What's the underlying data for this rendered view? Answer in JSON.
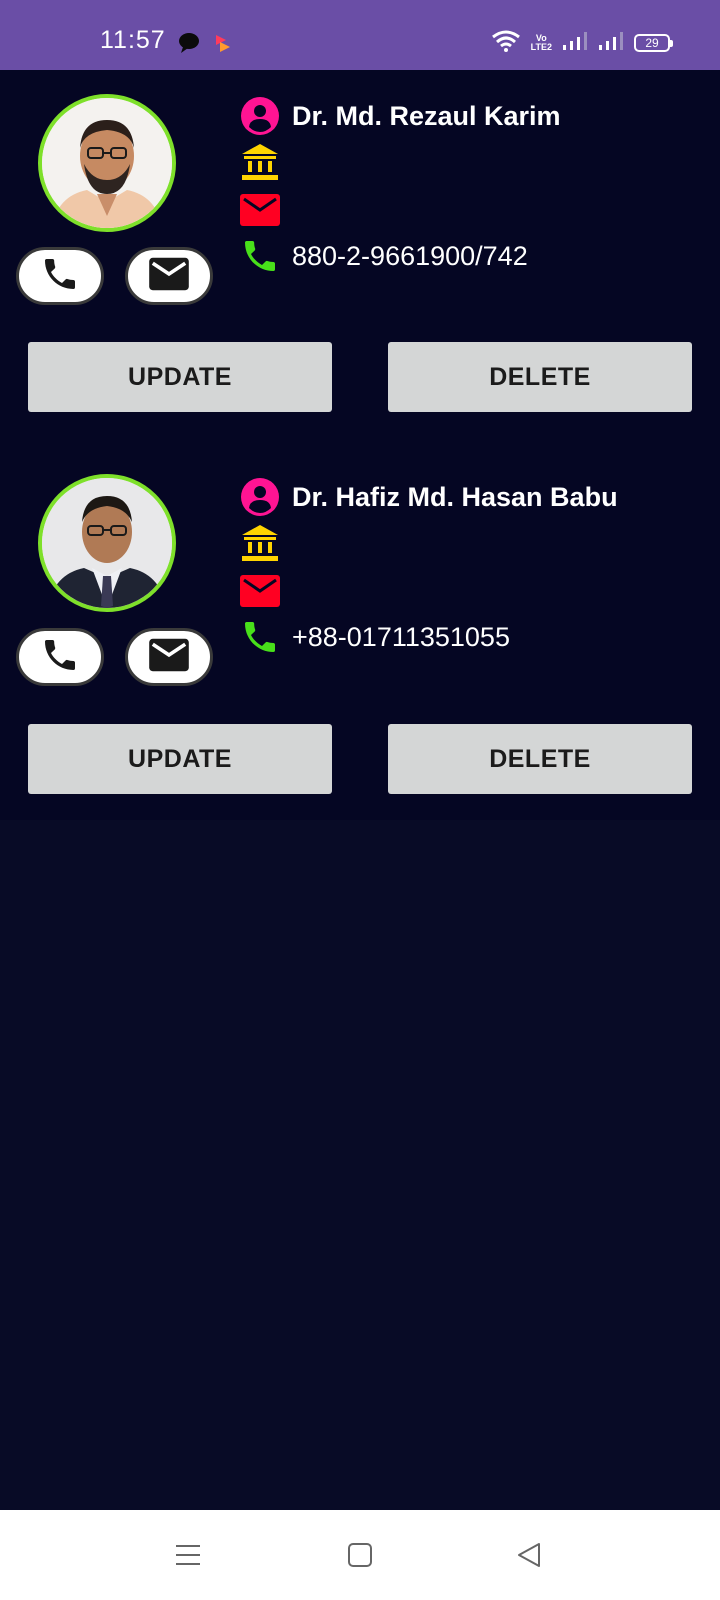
{
  "status_bar": {
    "time": "11:57",
    "network_label_top": "Vo",
    "network_label_bottom": "LTE2",
    "battery": "29"
  },
  "contacts": [
    {
      "name": "Dr. Md. Rezaul Karim",
      "institution": "",
      "email": "",
      "phone": "880-2-9661900/742",
      "update_label": "UPDATE",
      "delete_label": "DELETE"
    },
    {
      "name": "Dr. Hafiz Md. Hasan Babu",
      "institution": "",
      "email": "",
      "phone": "+88-01711351055",
      "update_label": "UPDATE",
      "delete_label": "DELETE"
    }
  ],
  "colors": {
    "status_bar": "#6a4ea6",
    "background": "#080b26",
    "card": "#050623",
    "avatar_border": "#7ee02a",
    "person_icon": "#ff1493",
    "institution_icon": "#ffd400",
    "email_icon": "#ff0022",
    "phone_icon": "#48e01a",
    "button_bg": "#d4d6d6"
  },
  "icons": {
    "row_icons": [
      "person-icon",
      "institution-icon",
      "email-icon",
      "phone-icon"
    ],
    "round_buttons": [
      "call-icon",
      "mail-icon"
    ],
    "nav": [
      "menu-icon",
      "home-icon",
      "back-icon"
    ]
  }
}
